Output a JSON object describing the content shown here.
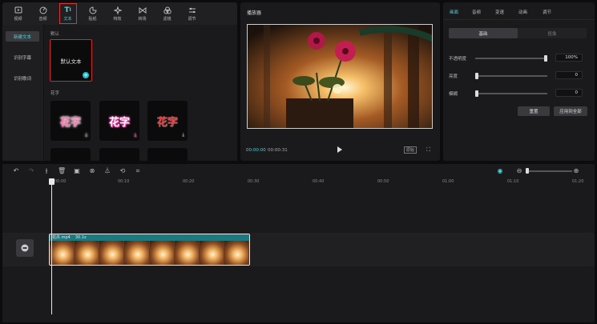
{
  "toolbar": {
    "tools": [
      {
        "label": "视频",
        "icon": "video-icon"
      },
      {
        "label": "音频",
        "icon": "audio-icon"
      },
      {
        "label": "文本",
        "icon": "text-icon",
        "active": true
      },
      {
        "label": "贴纸",
        "icon": "sticker-icon"
      },
      {
        "label": "特效",
        "icon": "effects-icon"
      },
      {
        "label": "转场",
        "icon": "transition-icon"
      },
      {
        "label": "滤镜",
        "icon": "filter-icon"
      },
      {
        "label": "调节",
        "icon": "adjust-icon"
      }
    ]
  },
  "text_panel": {
    "subnav": [
      "新建文本",
      "识别字幕",
      "识别歌词"
    ],
    "default_section": "默认",
    "default_card_label": "默认文本",
    "fancy_section": "花字",
    "fancy_samples": [
      "花字",
      "花字",
      "花字"
    ]
  },
  "player": {
    "title": "播放器",
    "time_current": "00:00:00",
    "time_total": "00:00:31",
    "ratio_label": "原始"
  },
  "inspector": {
    "tabs": [
      "画面",
      "音频",
      "变速",
      "动画",
      "调节"
    ],
    "segments": [
      "基础",
      "抠像"
    ],
    "props": [
      {
        "label": "不透明度",
        "value": "100%",
        "level": 1.0
      },
      {
        "label": "亮度",
        "value": "0",
        "level": 0.0
      },
      {
        "label": "模糊",
        "value": "0",
        "level": 0.0
      }
    ],
    "reset_label": "重置",
    "apply_all_label": "应用到全部"
  },
  "timeline": {
    "ruler": [
      "00:00",
      "00:10",
      "00:20",
      "00:30",
      "00:40",
      "00:50",
      "01:00",
      "01:10",
      "01:20"
    ],
    "clip": {
      "name": "花卉.mp4",
      "duration": "30.1s",
      "frames": 8
    }
  },
  "colors": {
    "accent": "#4fd0dc",
    "selection": "#d02828",
    "clip": "#1a7a80"
  }
}
